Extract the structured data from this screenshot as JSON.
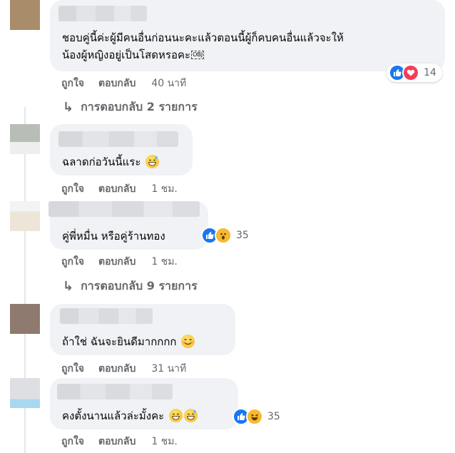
{
  "colors": {
    "bubble": "#f0f2f5",
    "meta_text": "#65676b",
    "like_blue": "#1877f2",
    "love_red": "#f33e58",
    "wow_yellow": "#f7b92d"
  },
  "labels": {
    "like": "ถูกใจ",
    "reply": "ตอบกลับ"
  },
  "comments": [
    {
      "text_line1": "ชอบคู่นี้ค่ะผู้มีคนอื่นก่อนนะคะแล้วตอนนี้ผู้ก็คบคนอื่นแล้วจะให้",
      "text_line2": "น้องผู้หญิงอยู่เป็นโสดหรอคะ",
      "obj_glyph": "OBJ",
      "time": "40 นาที",
      "reactions": [
        "like",
        "love"
      ],
      "reaction_count": "14",
      "replies_label": "การตอบกลับ 2 รายการ"
    },
    {
      "text": "ฉลาดก่อวันนี้แระ",
      "emoji": [
        "grinning-sweat"
      ],
      "time": "1 ชม."
    },
    {
      "text": "คู่พี่หมื่น หรือคู่ร้านทอง",
      "time": "1 ชม.",
      "reactions": [
        "like",
        "wow"
      ],
      "reaction_count": "35",
      "replies_label": "การตอบกลับ 9 รายการ"
    },
    {
      "text": "ถ้าใช่ ฉันจะยินดีมากกกก",
      "emoji": [
        "smiling"
      ],
      "time": "31 นาที"
    },
    {
      "text": "คงตั้งนานแล้วล่ะมั้งคะ",
      "emoji": [
        "grinning",
        "grinning-sweat"
      ],
      "time": "1 ชม.",
      "reactions": [
        "like",
        "laugh"
      ],
      "reaction_count": "35"
    }
  ]
}
